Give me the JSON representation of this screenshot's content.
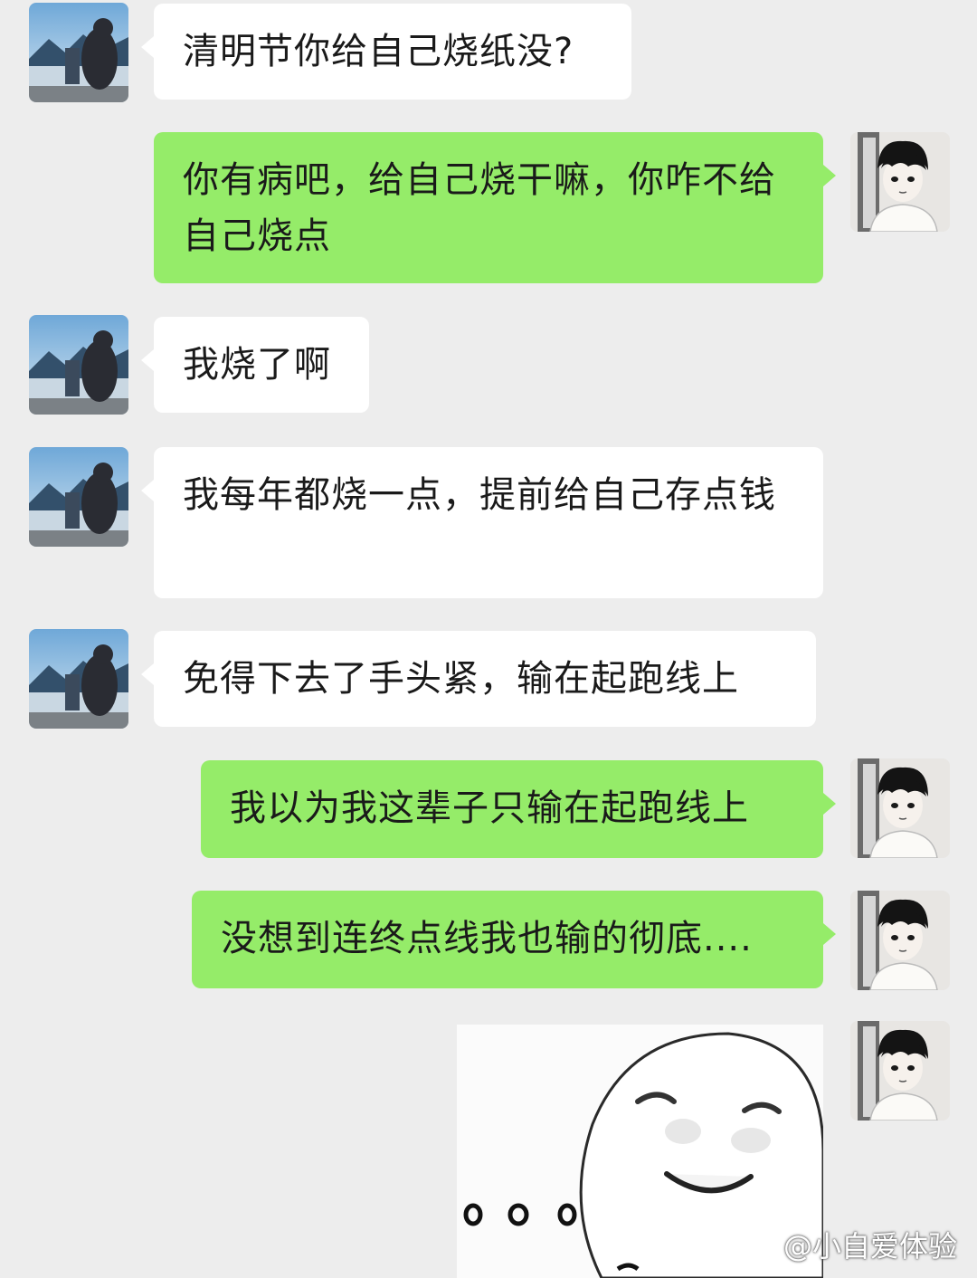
{
  "messages": [
    {
      "side": "in",
      "text": "清明节你给自己烧纸没?"
    },
    {
      "side": "out",
      "text": "你有病吧，给自己烧干嘛，你咋不给自己烧点"
    },
    {
      "side": "in",
      "text": "我烧了啊"
    },
    {
      "side": "in",
      "text": "我每年都烧一点，提前给自己存点钱"
    },
    {
      "side": "in",
      "text": "免得下去了手头紧，输在起跑线上"
    },
    {
      "side": "out",
      "text": "我以为我这辈子只输在起跑线上"
    },
    {
      "side": "out",
      "text": "没想到连终点线我也输的彻底...."
    }
  ],
  "sticker": {
    "icon": "smiling-face-sticker"
  },
  "avatars": {
    "left": "landscape-person-avatar",
    "right": "anime-boy-avatar"
  },
  "watermark": {
    "text": "@小自爱体验"
  },
  "colors": {
    "background": "#ededed",
    "incoming_bubble": "#ffffff",
    "outgoing_bubble": "#95ec69"
  }
}
